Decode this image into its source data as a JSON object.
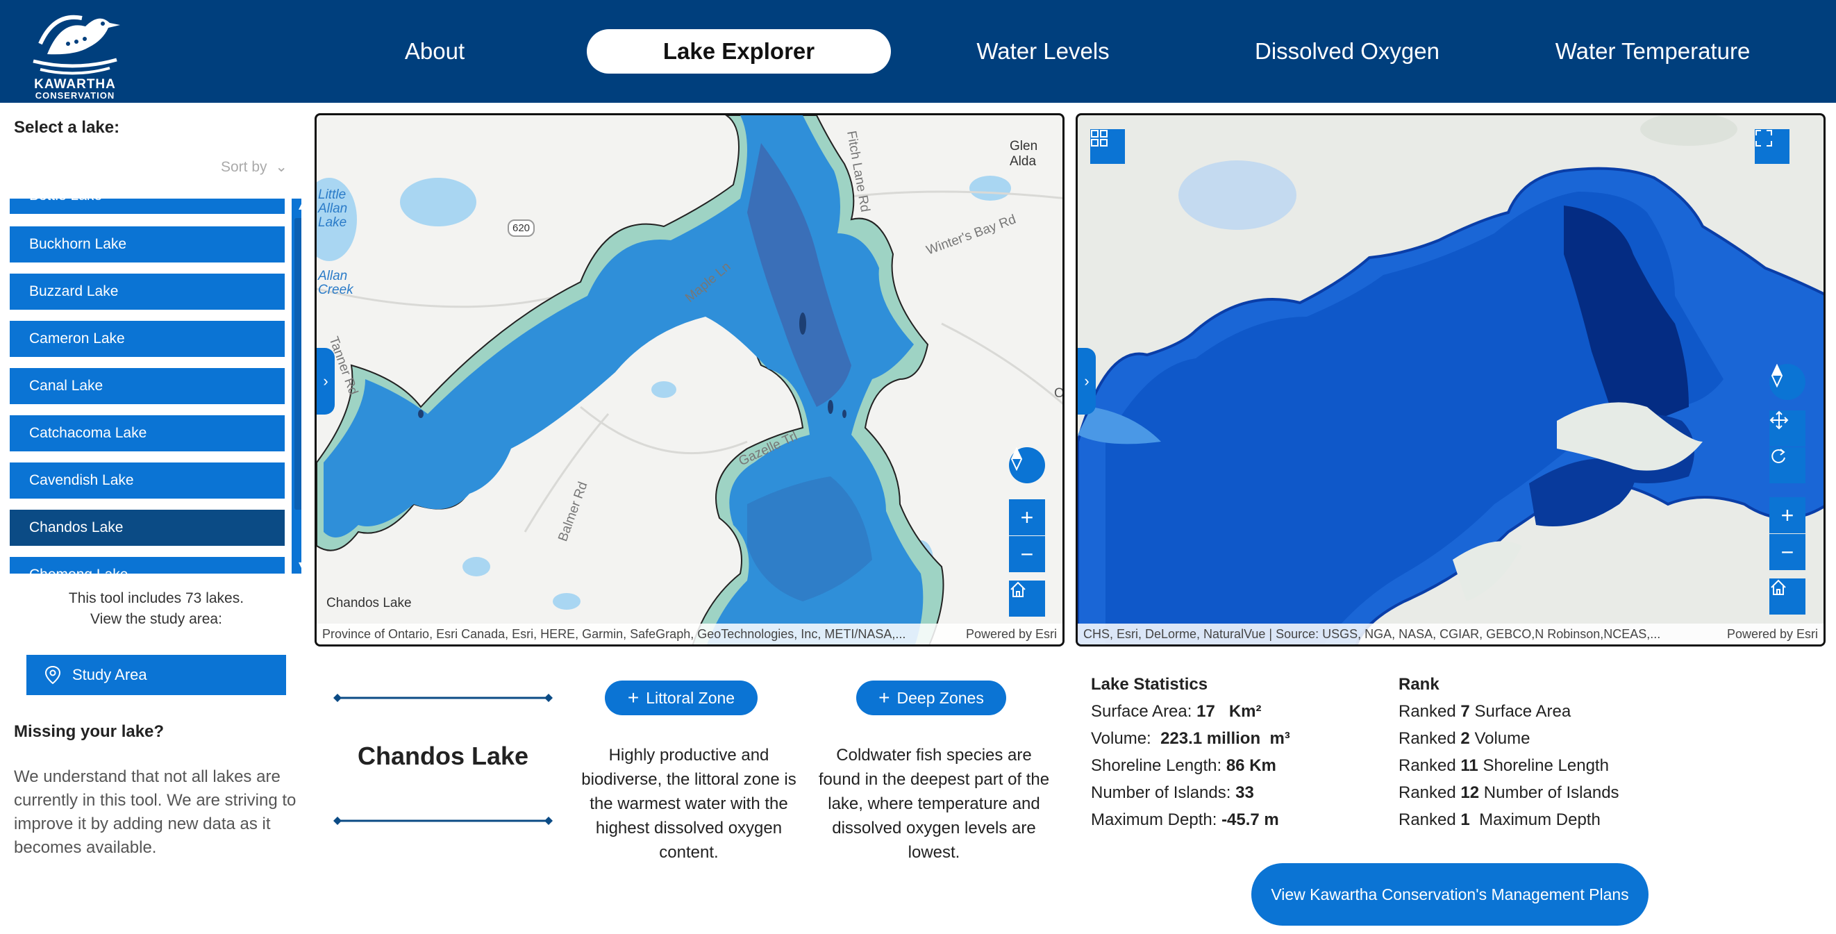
{
  "logo": {
    "line1": "KAWARTHA",
    "line2": "CONSERVATION"
  },
  "nav": [
    "About",
    "Lake Explorer",
    "Water Levels",
    "Dissolved Oxygen",
    "Water Temperature"
  ],
  "sidebar": {
    "title": "Select a lake:",
    "sort_label": "Sort by",
    "lakes": [
      "Bottle Lake",
      "Buckhorn Lake",
      "Buzzard Lake",
      "Cameron Lake",
      "Canal Lake",
      "Catchacoma Lake",
      "Cavendish Lake",
      "Chandos Lake",
      "Chemong Lake"
    ],
    "selected": "Chandos Lake",
    "count_note": "This tool includes 73 lakes.",
    "study_note": "View the study area:",
    "study_button": "Study Area",
    "missing_title": "Missing your lake?",
    "missing_text": "We understand that not all lakes are currently in this tool. We are striving to improve it by adding new data as it becomes available."
  },
  "map_left": {
    "labels": [
      "Glen Alda",
      "Chandos Lake",
      "Maple Ln",
      "Gazelle Trl",
      "Balmer Rd",
      "Winter's Bay Rd",
      "Fitch Lane Rd",
      "Tanner Rd",
      "620",
      "Little Allan Lake",
      "Allan Creek",
      "O"
    ],
    "attribution": "Province of Ontario, Esri Canada, Esri, HERE, Garmin, SafeGraph, GeoTechnologies, Inc, METI/NASA,...",
    "powered": "Powered by Esri"
  },
  "map_right": {
    "attribution": "CHS, Esri, DeLorme, NaturalVue | Source: USGS, NGA, NASA, CGIAR, GEBCO,N Robinson,NCEAS,...",
    "powered": "Powered by Esri"
  },
  "detail": {
    "lake_name": "Chandos Lake",
    "littoral_button": "Littoral Zone",
    "deep_button": "Deep Zones",
    "littoral_text": "Highly productive and biodiverse, the littoral zone is the warmest water with the highest dissolved oxygen content.",
    "deep_text": "Coldwater fish species are found in the deepest part of the lake, where temperature and dissolved oxygen levels are lowest."
  },
  "stats": {
    "heading": "Lake Statistics",
    "rows": [
      {
        "label": "Surface Area:",
        "value": "17",
        "unit": "Km²"
      },
      {
        "label": "Volume:",
        "value": "223.1 million",
        "unit": "m³"
      },
      {
        "label": "Shoreline Length:",
        "value": "86 Km",
        "unit": ""
      },
      {
        "label": "Number of Islands:",
        "value": "33",
        "unit": ""
      },
      {
        "label": "Maximum Depth:",
        "value": "-45.7 m",
        "unit": ""
      }
    ]
  },
  "rank": {
    "heading": "Rank",
    "prefix": "Ranked",
    "rows": [
      {
        "rank": "7",
        "label": "Surface Area"
      },
      {
        "rank": "2",
        "label": "Volume"
      },
      {
        "rank": "11",
        "label": "Shoreline Length"
      },
      {
        "rank": "12",
        "label": "Number of Islands"
      },
      {
        "rank": "1",
        "label": "Maximum Depth"
      }
    ]
  },
  "management_button": "View Kawartha Conservation's Management Plans",
  "colors": {
    "header": "#003f7d",
    "button": "#0b74d4",
    "selected": "#0b4b85"
  }
}
